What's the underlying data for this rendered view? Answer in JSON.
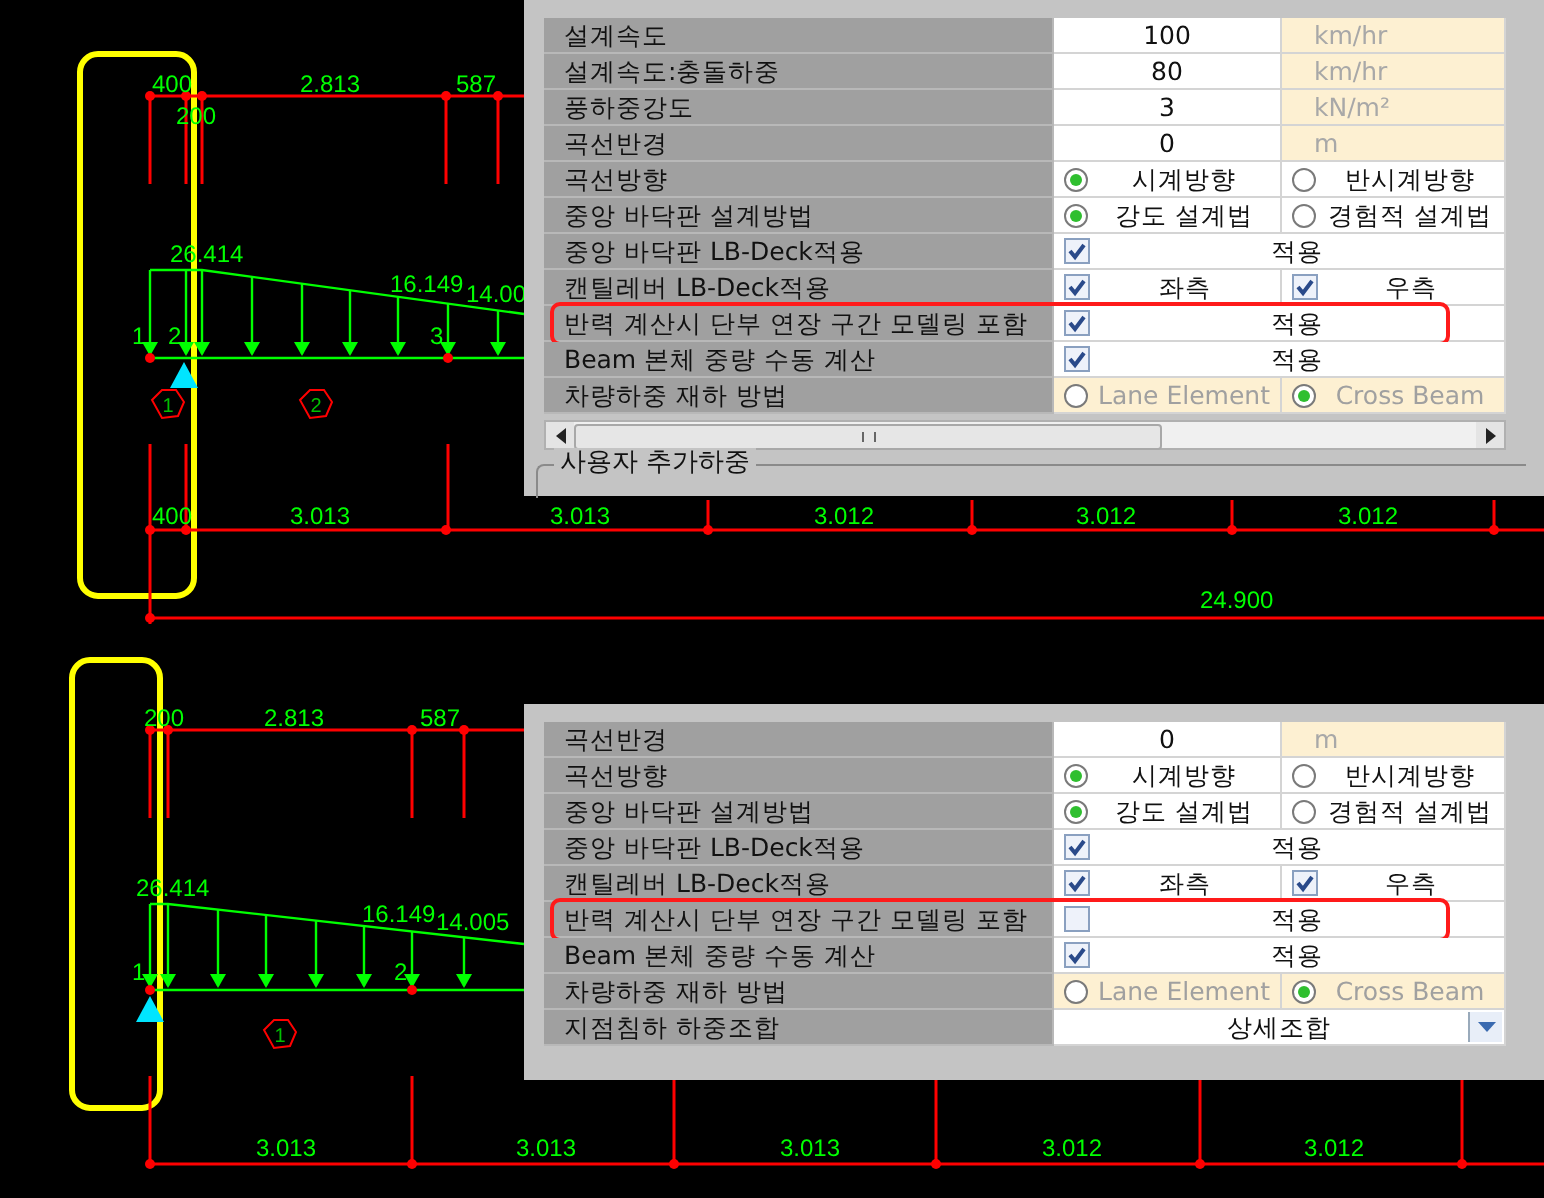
{
  "panels": [
    {
      "drawing": {
        "top_dimensions": [
          "400",
          "2.813",
          "587"
        ],
        "offset_label": "200",
        "load_labels": [
          "26.414",
          "16.149",
          "14.00"
        ],
        "node_labels": [
          "1",
          "2",
          "3"
        ],
        "element_labels": [
          "1",
          "2"
        ],
        "bottom_dimensions": [
          "400",
          "3.013",
          "3.013",
          "3.012",
          "3.012",
          "3.012"
        ],
        "total_dimension": "24.900"
      },
      "properties": {
        "horizontal_scrollbar": true,
        "group_label": "사용자 추가하중",
        "rows": [
          {
            "kind": "value",
            "label": "설계속도",
            "value": "100",
            "unit": "km/hr",
            "highlighted": false
          },
          {
            "kind": "value",
            "label": "설계속도:충돌하중",
            "value": "80",
            "unit": "km/hr",
            "highlighted": false
          },
          {
            "kind": "value",
            "label": "풍하중강도",
            "value": "3",
            "unit": "kN/m²",
            "highlighted": false
          },
          {
            "kind": "value",
            "label": "곡선반경",
            "value": "0",
            "unit": "m",
            "highlighted": false
          },
          {
            "kind": "radio",
            "label": "곡선방향",
            "disabled": false,
            "highlighted": false,
            "options": [
              {
                "label": "시계방향",
                "selected": true
              },
              {
                "label": "반시계방향",
                "selected": false
              }
            ]
          },
          {
            "kind": "radio",
            "label": "중앙 바닥판 설계방법",
            "disabled": false,
            "highlighted": false,
            "options": [
              {
                "label": "강도 설계법",
                "selected": true
              },
              {
                "label": "경험적 설계법",
                "selected": false
              }
            ]
          },
          {
            "kind": "check",
            "label": "중앙 바닥판 LB-Deck적용",
            "checked": true,
            "text": "적용",
            "highlighted": false
          },
          {
            "kind": "check_pair",
            "label": "캔틸레버 LB-Deck적용",
            "highlighted": false,
            "options": [
              {
                "label": "좌측",
                "checked": true
              },
              {
                "label": "우측",
                "checked": true
              }
            ]
          },
          {
            "kind": "check",
            "label": "반력 계산시 단부 연장 구간 모델링 포함",
            "checked": true,
            "text": "적용",
            "highlighted": true
          },
          {
            "kind": "check",
            "label": "Beam 본체 중량 수동 계산",
            "checked": true,
            "text": "적용",
            "highlighted": false
          },
          {
            "kind": "radio",
            "label": "차량하중 재하 방법",
            "disabled": true,
            "highlighted": false,
            "options": [
              {
                "label": "Lane Element",
                "selected": false
              },
              {
                "label": "Cross Beam",
                "selected": true
              }
            ]
          }
        ]
      }
    },
    {
      "drawing": {
        "top_dimensions": [
          "200",
          "2.813",
          "587"
        ],
        "load_labels": [
          "26.414",
          "16.149",
          "14.005"
        ],
        "node_labels": [
          "1",
          "2"
        ],
        "element_labels": [
          "1"
        ],
        "bottom_dimensions": [
          "3.013",
          "3.013",
          "3.013",
          "3.012",
          "3.012"
        ]
      },
      "properties": {
        "horizontal_scrollbar": false,
        "rows": [
          {
            "kind": "value",
            "label": "곡선반경",
            "value": "0",
            "unit": "m",
            "highlighted": false
          },
          {
            "kind": "radio",
            "label": "곡선방향",
            "disabled": false,
            "highlighted": false,
            "options": [
              {
                "label": "시계방향",
                "selected": true
              },
              {
                "label": "반시계방향",
                "selected": false
              }
            ]
          },
          {
            "kind": "radio",
            "label": "중앙 바닥판 설계방법",
            "disabled": false,
            "highlighted": false,
            "options": [
              {
                "label": "강도 설계법",
                "selected": true
              },
              {
                "label": "경험적 설계법",
                "selected": false
              }
            ]
          },
          {
            "kind": "check",
            "label": "중앙 바닥판 LB-Deck적용",
            "checked": true,
            "text": "적용",
            "highlighted": false
          },
          {
            "kind": "check_pair",
            "label": "캔틸레버 LB-Deck적용",
            "highlighted": false,
            "options": [
              {
                "label": "좌측",
                "checked": true
              },
              {
                "label": "우측",
                "checked": true
              }
            ]
          },
          {
            "kind": "check",
            "label": "반력 계산시 단부 연장 구간 모델링 포함",
            "checked": false,
            "text": "적용",
            "highlighted": true
          },
          {
            "kind": "check",
            "label": "Beam 본체 중량 수동 계산",
            "checked": true,
            "text": "적용",
            "highlighted": false
          },
          {
            "kind": "radio",
            "label": "차량하중 재하 방법",
            "disabled": true,
            "highlighted": false,
            "options": [
              {
                "label": "Lane Element",
                "selected": false
              },
              {
                "label": "Cross Beam",
                "selected": true
              }
            ]
          },
          {
            "kind": "combo",
            "label": "지점침하 하중조합",
            "value": "상세조합",
            "highlighted": false
          }
        ]
      }
    }
  ]
}
